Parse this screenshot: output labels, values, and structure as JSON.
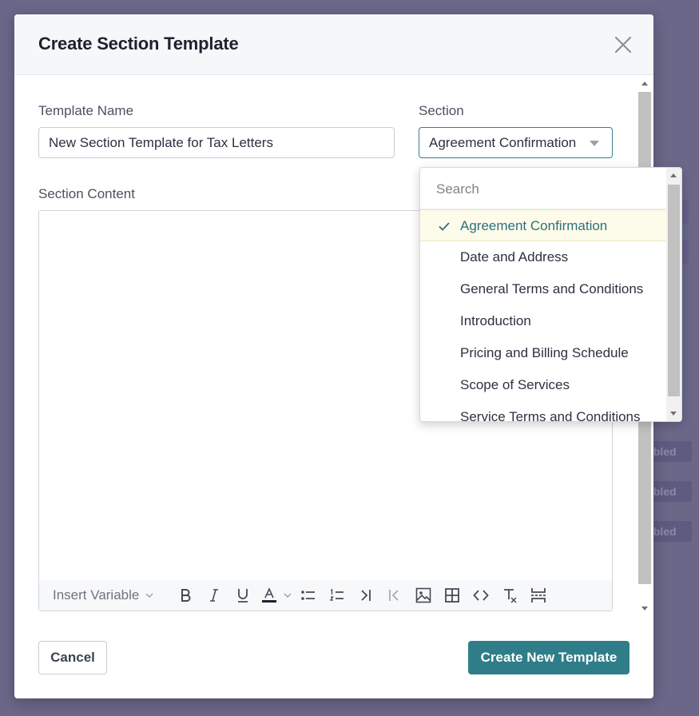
{
  "modal": {
    "title": "Create Section Template"
  },
  "form": {
    "template_name_label": "Template Name",
    "template_name_value": "New Section Template for Tax Letters",
    "section_label": "Section",
    "section_selected": "Agreement Confirmation",
    "section_content_label": "Section Content"
  },
  "toolbar": {
    "insert_variable_label": "Insert Variable"
  },
  "dropdown": {
    "search_placeholder": "Search",
    "options": [
      "Agreement Confirmation",
      "Date and Address",
      "General Terms and Conditions",
      "Introduction",
      "Pricing and Billing Schedule",
      "Scope of Services",
      "Service Terms and Conditions"
    ]
  },
  "footer": {
    "cancel_label": "Cancel",
    "create_label": "Create New Template"
  },
  "background": {
    "badges": [
      "abled",
      "abled",
      "abled"
    ]
  },
  "colors": {
    "primary": "#2f7d89",
    "overlay": "#6a6789",
    "selected_bg": "#fdfbe9"
  }
}
